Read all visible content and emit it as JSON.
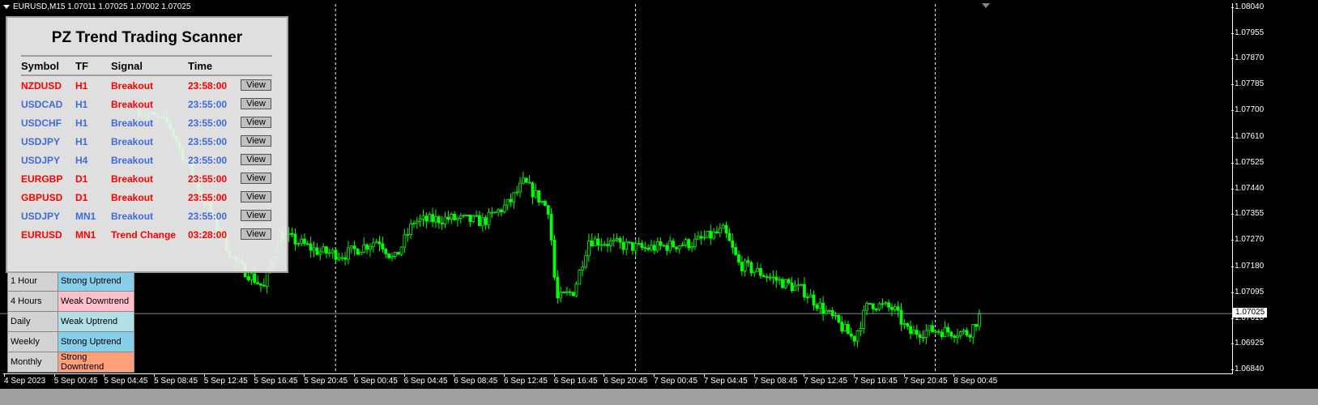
{
  "window": {
    "title": "EURUSD,M15  1.07011 1.07025 1.07002 1.07025"
  },
  "colors": {
    "bull": "#00ff00",
    "red": "#ff0000",
    "blue": "#4169e1"
  },
  "scanner": {
    "title": "PZ Trend Trading Scanner",
    "headers": [
      "Symbol",
      "TF",
      "Signal",
      "Time"
    ],
    "rows": [
      {
        "symbol": "NZDUSD",
        "tf": "H1",
        "signal": "Breakout",
        "time": "23:58:00",
        "color": "red",
        "signal_color": "red",
        "button": "View"
      },
      {
        "symbol": "USDCAD",
        "tf": "H1",
        "signal": "Breakout",
        "time": "23:55:00",
        "color": "blue",
        "signal_color": "red",
        "button": "View"
      },
      {
        "symbol": "USDCHF",
        "tf": "H1",
        "signal": "Breakout",
        "time": "23:55:00",
        "color": "blue",
        "signal_color": "blue",
        "button": "View"
      },
      {
        "symbol": "USDJPY",
        "tf": "H1",
        "signal": "Breakout",
        "time": "23:55:00",
        "color": "blue",
        "signal_color": "blue",
        "button": "View"
      },
      {
        "symbol": "USDJPY",
        "tf": "H4",
        "signal": "Breakout",
        "time": "23:55:00",
        "color": "blue",
        "signal_color": "blue",
        "button": "View"
      },
      {
        "symbol": "EURGBP",
        "tf": "D1",
        "signal": "Breakout",
        "time": "23:55:00",
        "color": "red",
        "signal_color": "red",
        "button": "View"
      },
      {
        "symbol": "GBPUSD",
        "tf": "D1",
        "signal": "Breakout",
        "time": "23:55:00",
        "color": "red",
        "signal_color": "red",
        "button": "View"
      },
      {
        "symbol": "USDJPY",
        "tf": "MN1",
        "signal": "Breakout",
        "time": "23:55:00",
        "color": "blue",
        "signal_color": "blue",
        "button": "View"
      },
      {
        "symbol": "EURUSD",
        "tf": "MN1",
        "signal": "Trend Change",
        "time": "03:28:00",
        "color": "red",
        "signal_color": "red",
        "button": "View"
      }
    ]
  },
  "dashboard": {
    "rows": [
      {
        "timeframe": "1 Hour",
        "status": "Strong Uptrend",
        "bg": "#87ceeb"
      },
      {
        "timeframe": "4 Hours",
        "status": "Weak Downtrend",
        "bg": "#ffc0cb"
      },
      {
        "timeframe": "Daily",
        "status": "Weak Uptrend",
        "bg": "#b0e0e6"
      },
      {
        "timeframe": "Weekly",
        "status": "Strong Uptrend",
        "bg": "#87ceeb"
      },
      {
        "timeframe": "Monthly",
        "status": "Strong Downtrend",
        "bg": "#ffa07a"
      }
    ]
  },
  "chart_data": {
    "type": "candlestick",
    "symbol": "EURUSD",
    "timeframe": "M15",
    "ohlc_last": {
      "open": 1.07011,
      "high": 1.07025,
      "low": 1.07002,
      "close": 1.07025
    },
    "current_price": "1.07025",
    "ylim": [
      1.0684,
      1.0804
    ],
    "price_ticks": [
      "1.08040",
      "1.07955",
      "1.07870",
      "1.07785",
      "1.07700",
      "1.07610",
      "1.07525",
      "1.07440",
      "1.07355",
      "1.07270",
      "1.07180",
      "1.07095",
      "1.07010",
      "1.06925",
      "1.06840"
    ],
    "time_ticks": [
      "4 Sep 2023",
      "5 Sep 00:45",
      "5 Sep 04:45",
      "5 Sep 08:45",
      "5 Sep 12:45",
      "5 Sep 16:45",
      "5 Sep 20:45",
      "6 Sep 00:45",
      "6 Sep 04:45",
      "6 Sep 08:45",
      "6 Sep 12:45",
      "6 Sep 16:45",
      "6 Sep 20:45",
      "7 Sep 00:45",
      "7 Sep 04:45",
      "7 Sep 08:45",
      "7 Sep 12:45",
      "7 Sep 16:45",
      "7 Sep 20:45",
      "8 Sep 00:45"
    ],
    "day_separators_after_tick": [
      6,
      12,
      18
    ],
    "price_path_by_tick": [
      [
        2.7,
        1.077
      ],
      [
        3.3,
        1.0765
      ],
      [
        4.0,
        1.074
      ],
      [
        4.6,
        1.072
      ],
      [
        5.2,
        1.0711
      ],
      [
        5.5,
        1.0729
      ],
      [
        6.3,
        1.0723
      ],
      [
        6.8,
        1.0722
      ],
      [
        7.5,
        1.0727
      ],
      [
        7.8,
        1.072
      ],
      [
        8.2,
        1.0733
      ],
      [
        8.9,
        1.0734
      ],
      [
        9.6,
        1.0733
      ],
      [
        10.1,
        1.0739
      ],
      [
        10.4,
        1.0746
      ],
      [
        10.9,
        1.0737
      ],
      [
        11.05,
        1.0707
      ],
      [
        11.4,
        1.071
      ],
      [
        11.7,
        1.0727
      ],
      [
        12.8,
        1.0724
      ],
      [
        13.8,
        1.0726
      ],
      [
        14.4,
        1.073
      ],
      [
        14.7,
        1.0719
      ],
      [
        15.4,
        1.0714
      ],
      [
        16.0,
        1.071
      ],
      [
        16.7,
        1.0699
      ],
      [
        17.0,
        1.0694
      ],
      [
        17.3,
        1.0706
      ],
      [
        17.8,
        1.0704
      ],
      [
        18.1,
        1.0696
      ],
      [
        18.6,
        1.0697
      ],
      [
        19.3,
        1.0696
      ],
      [
        19.55,
        1.07025
      ]
    ]
  }
}
